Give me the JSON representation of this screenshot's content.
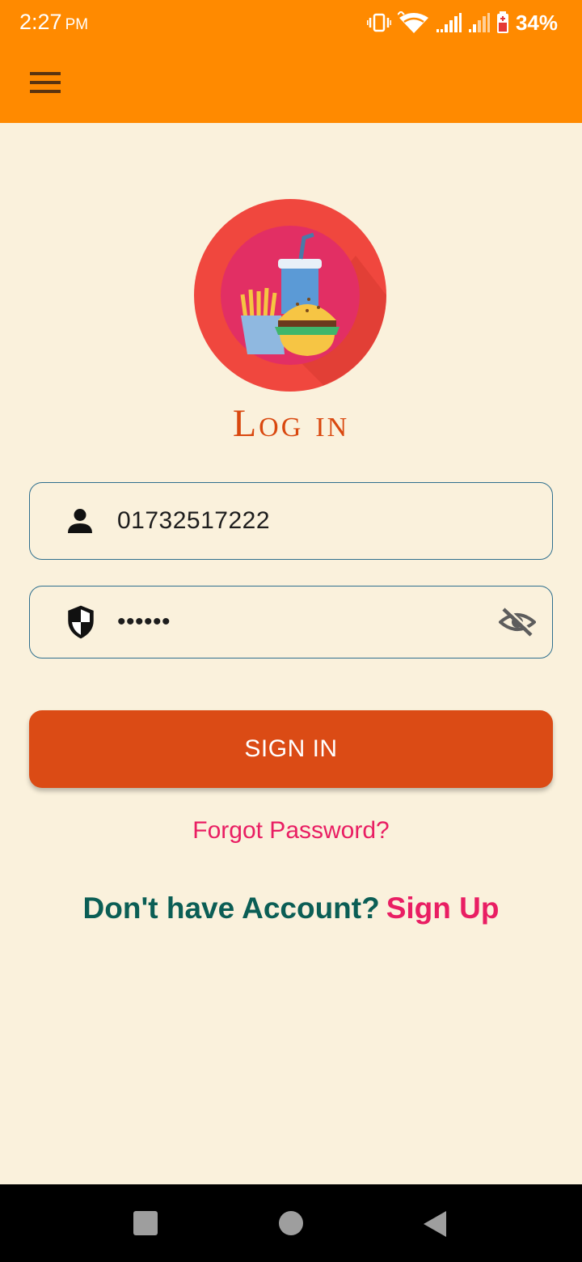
{
  "status_bar": {
    "time": "2:27",
    "ampm": "PM",
    "battery": "34%",
    "icons": [
      "vibrate-icon",
      "wifi-icon",
      "signal-icon",
      "signal-icon",
      "battery-icon"
    ]
  },
  "app_bar": {
    "menu_icon": "hamburger-menu-icon"
  },
  "colors": {
    "app_bar": "#ff8a00",
    "background": "#faf1dc",
    "accent": "#db4b15",
    "link": "#e91e63",
    "question": "#0b5e55"
  },
  "login": {
    "title": "Log in",
    "username": {
      "value": "01732517222",
      "icon": "person-icon"
    },
    "password": {
      "value": "••••••",
      "icon": "shield-icon",
      "toggle_icon": "eye-off-icon"
    },
    "sign_in_label": "SIGN IN",
    "forgot_label": "Forgot Password?",
    "no_account_label": "Don't have Account?",
    "sign_up_label": "Sign Up"
  },
  "nav_bar": {
    "buttons": [
      "recents-square-icon",
      "home-circle-icon",
      "back-triangle-icon"
    ]
  }
}
